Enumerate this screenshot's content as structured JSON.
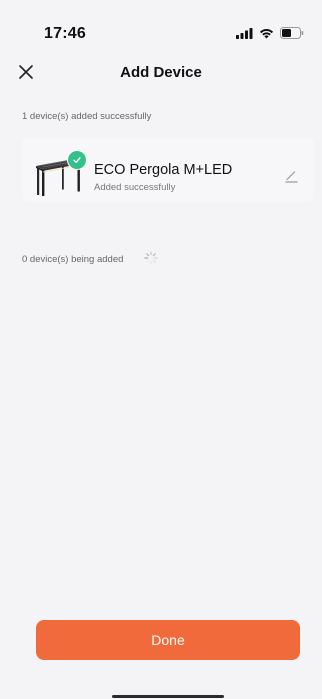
{
  "status_bar": {
    "time": "17:46",
    "icons": [
      "signal-icon",
      "wifi-icon",
      "battery-icon"
    ]
  },
  "nav": {
    "title": "Add Device",
    "close_icon": "close-icon"
  },
  "added_section": {
    "label": "1 device(s) added successfully",
    "devices": [
      {
        "name": "ECO Pergola M+LED",
        "status": "Added successfully",
        "image_icon": "pergola-icon",
        "badge_icon": "check-icon",
        "edit_icon": "edit-pencil-icon"
      }
    ]
  },
  "adding_section": {
    "label": "0 device(s) being added",
    "spinner_icon": "loading-spinner-icon"
  },
  "footer": {
    "done_label": "Done"
  },
  "colors": {
    "accent": "#f06a3b",
    "success": "#33c08b",
    "background": "#f4f4f6"
  }
}
